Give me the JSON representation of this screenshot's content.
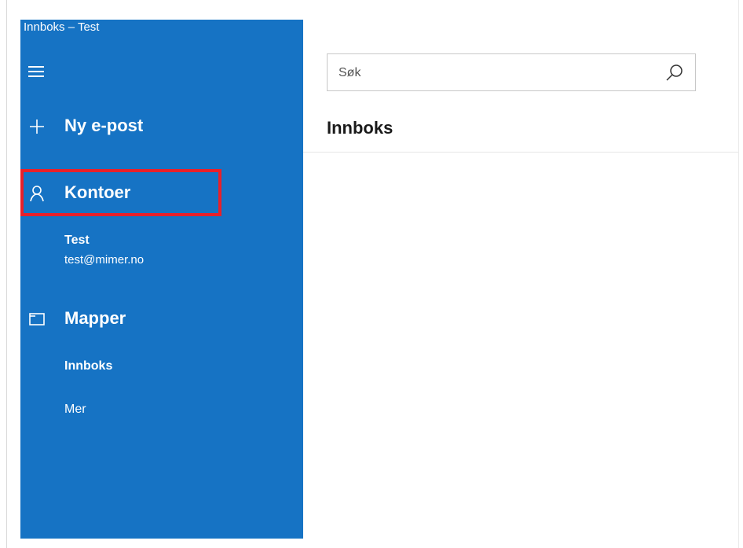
{
  "window": {
    "title": "Innboks – Test"
  },
  "sidebar": {
    "background_color": "#1673c4",
    "menu_icon": "hamburger-icon",
    "new_mail": {
      "label": "Ny e-post",
      "icon": "plus-icon"
    },
    "accounts": {
      "label": "Kontoer",
      "icon": "person-icon",
      "highlight_color": "#e8202a",
      "items": [
        {
          "name": "Test",
          "email": "test@mimer.no"
        }
      ]
    },
    "folders": {
      "label": "Mapper",
      "icon": "folder-icon",
      "items": [
        {
          "label": "Innboks",
          "selected": true
        },
        {
          "label": "Mer",
          "selected": false
        }
      ]
    }
  },
  "main": {
    "search": {
      "placeholder": "Søk",
      "value": "",
      "icon": "search-icon"
    },
    "list_title": "Innboks"
  }
}
